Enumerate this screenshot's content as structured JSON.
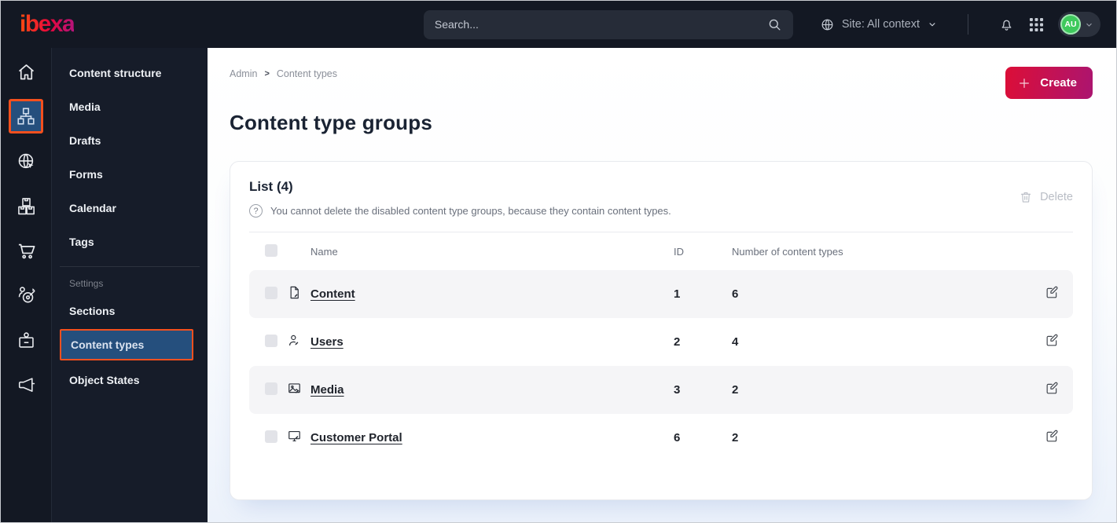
{
  "topbar": {
    "logo_text": "ibexa",
    "search_placeholder": "Search...",
    "site_context_label": "Site: All context",
    "avatar_initials": "AU"
  },
  "sidebar": {
    "items": [
      "Content structure",
      "Media",
      "Drafts",
      "Forms",
      "Calendar",
      "Tags"
    ],
    "settings_label": "Settings",
    "settings_items": [
      "Sections",
      "Content types",
      "Object States"
    ],
    "active_item": "Content types"
  },
  "breadcrumb": {
    "items": [
      "Admin",
      "Content types"
    ],
    "separator": ">"
  },
  "page": {
    "title": "Content type groups",
    "create_label": "Create"
  },
  "list": {
    "title": "List (4)",
    "help_glyph": "?",
    "note": "You cannot delete the disabled content type groups, because they contain content types.",
    "delete_label": "Delete",
    "columns": [
      "Name",
      "ID",
      "Number of content types"
    ],
    "rows": [
      {
        "name": "Content",
        "icon": "file-icon",
        "id": "1",
        "count": "6"
      },
      {
        "name": "Users",
        "icon": "user-icon",
        "id": "2",
        "count": "4"
      },
      {
        "name": "Media",
        "icon": "image-icon",
        "id": "3",
        "count": "2"
      },
      {
        "name": "Customer Portal",
        "icon": "monitor-icon",
        "id": "6",
        "count": "2"
      }
    ]
  },
  "colors": {
    "dark-bg": "#131823",
    "panel-bg": "#161c29",
    "active-blue": "#254f7d",
    "highlight-orange": "#f4501e",
    "create-from": "#dc0e37",
    "create-to": "#ab1570",
    "avatar-green": "#3ec95c",
    "ink": "#1a2333"
  }
}
